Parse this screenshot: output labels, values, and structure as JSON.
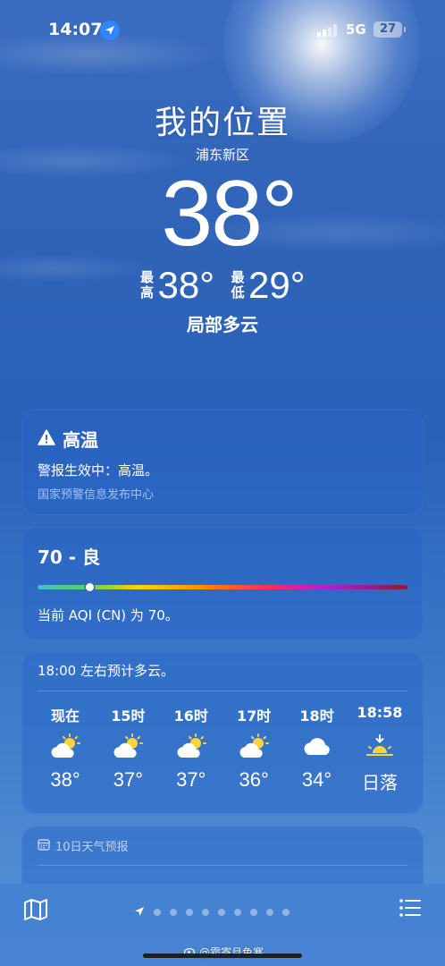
{
  "status_bar": {
    "time": "14:07",
    "network": "5G",
    "battery": "27"
  },
  "header": {
    "city": "我的位置",
    "district": "浦东新区",
    "temperature": "38°",
    "high_label": "最高",
    "high": "38°",
    "low_label": "最低",
    "low": "29°",
    "condition": "局部多云"
  },
  "alert": {
    "title": "高温",
    "text": "警报生效中：高温。",
    "source": "国家预警信息发布中心",
    "icon": "warning-icon"
  },
  "aqi": {
    "title": "70 - 良",
    "value": 70,
    "scale_max": 500,
    "text": "当前 AQI (CN) 为 70。"
  },
  "hourly": {
    "summary": "18:00 左右预计多云。",
    "items": [
      {
        "time": "现在",
        "icon": "partly-sunny-icon",
        "temp": "38°"
      },
      {
        "time": "15时",
        "icon": "partly-sunny-icon",
        "temp": "37°"
      },
      {
        "time": "16时",
        "icon": "partly-sunny-icon",
        "temp": "37°"
      },
      {
        "time": "17时",
        "icon": "partly-sunny-icon",
        "temp": "36°"
      },
      {
        "time": "18时",
        "icon": "cloud-icon",
        "temp": "34°"
      },
      {
        "time": "18:58",
        "icon": "sunset-icon",
        "temp": "日落"
      }
    ]
  },
  "forecast": {
    "title": "10日天气预报"
  },
  "bottom_bar": {
    "pages": 10,
    "current_page": 0
  },
  "watermark": "@霜寄月色寒",
  "colors": {
    "accent_blue": "#2f86ff",
    "sun_yellow": "#ffd43a"
  }
}
